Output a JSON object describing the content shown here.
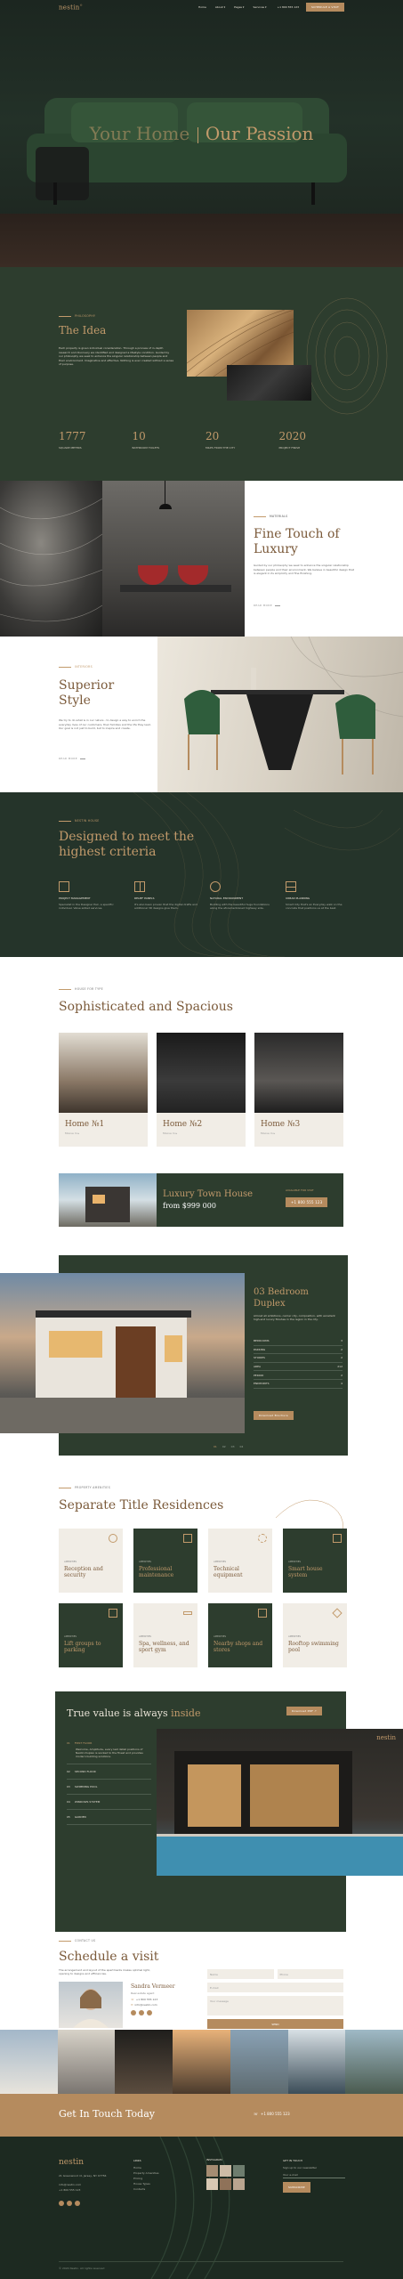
{
  "nav": {
    "logo": "nestin",
    "logo_mark": "®",
    "links": [
      "Home",
      "About ▾",
      "Pages ▾",
      "Services ▾"
    ],
    "phone": "+1 800 555 123",
    "cta": "SCHEDULE A VISIT"
  },
  "hero": {
    "title_light": "Your Home",
    "title_bold": "Our Passion"
  },
  "idea": {
    "eyebrow": "PHILOSOPHY",
    "title": "The Idea",
    "text": "Each property is given individual consideration. Through a process of in-depth research and discovery we identified and designed a lifestyle condition. Guided by our philosophy we seek to enhance the singular relationship between people and their environment. Imaginative and effective. Nothing is ever created without a sense of purpose.",
    "stats": [
      {
        "value": "1777",
        "label": "SQUARE METERS"
      },
      {
        "value": "10",
        "label": "BATHROOM TOILETS"
      },
      {
        "value": "20",
        "label": "MILES FROM THE CITY"
      },
      {
        "value": "2020",
        "label": "PROJECT FINISH"
      }
    ]
  },
  "luxury": {
    "eyebrow": "MATERIALS",
    "title": "Fine Touch of Luxury",
    "text": "Guided by our philosophy we seek to enhance the singular relationship between people and their environment. We believe in beautiful design that is elegant in its simplicity and fine finishing.",
    "link": "READ MORE"
  },
  "style": {
    "eyebrow": "INTERIORS",
    "title": "Superior Style",
    "text": "We try to do what is in our nature - to design a way to enrich the everyday lives of our customers, their families and the life they lead. Our goal is not just to build, but to inspire and create.",
    "link": "READ MORE"
  },
  "criteria": {
    "eyebrow": "NESTIN HOUSE",
    "title": "Designed to meet the highest criteria",
    "features": [
      {
        "icon": "blueprint-icon",
        "title": "PROJECT MANAGEMENT",
        "text": "Specialist in the Designer Pair, a specifiic individual. Value added services."
      },
      {
        "icon": "window-icon",
        "title": "RELIEF PANELS",
        "text": "It's also been proven that the digital drafts and additional 3D designs give them."
      },
      {
        "icon": "tree-icon",
        "title": "NATURAL ENVIRONMENT",
        "text": "Building with the beautiful huge foundations along the aforementioned highway side."
      },
      {
        "icon": "floorplan-icon",
        "title": "URBAN PLANNING",
        "text": "Smart City that's an Everyday walk on the concrete that positions us at the best."
      }
    ]
  },
  "houses": {
    "eyebrow": "HOUSE FOR TYPE",
    "title": "Sophisticated and Spacious",
    "cards": [
      {
        "name": "Home №1",
        "sub": "Moove In ▸"
      },
      {
        "name": "Home №2",
        "sub": "Moove In ▸"
      },
      {
        "name": "Home №3",
        "sub": "Moove In ▸"
      }
    ]
  },
  "banner": {
    "title": "Luxury Town House",
    "price": "from $999 000",
    "eyebrow": "AVAILABLE FOR VISIT",
    "phone": "+1 800 555 123"
  },
  "duplex": {
    "title": "03 Bedroom Duplex",
    "text": "Almost all ambitions, carrier city, composition, with excellent high-end luxury finishes in the region in the city.",
    "specs": [
      "BEDROOMS",
      "PARKING",
      "STORIES",
      "AREA",
      "PERIOD",
      "ENDPOINTS"
    ],
    "specs_values": [
      "3",
      "2",
      "2",
      "212",
      "2",
      "4"
    ],
    "cta": "Download Brochure",
    "slide": "01",
    "dots": [
      "01",
      "02",
      "03",
      "04"
    ]
  },
  "amenities": {
    "eyebrow": "PROPERTY AMENITIES",
    "title": "Separate Title Residences",
    "cards": [
      {
        "tag": "AMENITIES",
        "title": "Reception and security"
      },
      {
        "tag": "AMENITIES",
        "title": "Professional maintenance"
      },
      {
        "tag": "AMENITIES",
        "title": "Technical equipment"
      },
      {
        "tag": "AMENITIES",
        "title": "Smart house system"
      },
      {
        "tag": "AMENITIES",
        "title": "Lift groups to parking"
      },
      {
        "tag": "AMENITIES",
        "title": "Spa, wellness, and sport gym"
      },
      {
        "tag": "AMENITIES",
        "title": "Nearby shops and stores"
      },
      {
        "tag": "AMENITIES",
        "title": "Rooftop swimming pool"
      }
    ]
  },
  "inside": {
    "title_white": "True value is always",
    "title_gold": "inside",
    "cta": "Download PDF ↗",
    "logo": "nestin",
    "floors": [
      {
        "num": "01",
        "label": "FIRST FLOOR",
        "text": "Welcome, Amplitude, every last detail positions of Nestin Duplex is worked to the finest and provides modern building solutions."
      },
      {
        "num": "02",
        "label": "SECOND FLOOR"
      },
      {
        "num": "03",
        "label": "SWIMMING POOL"
      },
      {
        "num": "04",
        "label": "WINDOWS SYSTEM"
      },
      {
        "num": "05",
        "label": "GARDEN"
      }
    ]
  },
  "visit": {
    "eyebrow": "CONTACT US",
    "title": "Schedule a visit",
    "text": "The arrangement and layout of the apartments makes optimal light, opening to designs and efficiencies.",
    "agent_name": "Sandra Vermeer",
    "agent_role": "Real estate agent",
    "agent_phone": "+1 800 555 123",
    "agent_email": "info@nestin.com",
    "form": {
      "name": "Name",
      "phone": "Phone",
      "email": "E-mail",
      "message": "Your message",
      "submit": "SEND"
    }
  },
  "touch": {
    "title": "Get In Touch Today",
    "phone": "+1 800 555 123"
  },
  "footer": {
    "logo": "nestin",
    "address": "21 Greenwood rd, Jersey, NY 07756",
    "email": "info@nestin.com",
    "phone": "+1 800 555 123",
    "col1_title": "LINKS",
    "col1": [
      "Home",
      "Property Amenities",
      "Pricing",
      "House Types",
      "Contacts"
    ],
    "col2_title": "INSTAGRAM",
    "col3_title": "GET IN TOUCH",
    "col3": [
      "Sign up to our newsletter",
      "Your e-mail",
      "SUBSCRIBE"
    ],
    "copyright": "© 2024 Nestin. All rights reserved"
  },
  "colors": {
    "green": "#2d3d2e",
    "dark_green": "#1f2a20",
    "gold": "#c29a6b",
    "cream": "#f1ede6"
  }
}
